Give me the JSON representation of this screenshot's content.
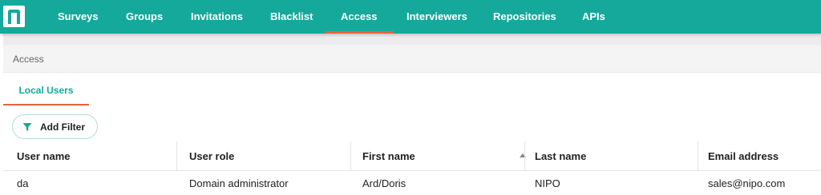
{
  "nav": {
    "items": [
      {
        "label": "Surveys"
      },
      {
        "label": "Groups"
      },
      {
        "label": "Invitations"
      },
      {
        "label": "Blacklist"
      },
      {
        "label": "Access",
        "active": true
      },
      {
        "label": "Interviewers"
      },
      {
        "label": "Repositories"
      },
      {
        "label": "APIs"
      }
    ]
  },
  "breadcrumb": "Access",
  "tabs": [
    {
      "label": "Local Users",
      "active": true
    }
  ],
  "toolbar": {
    "add_filter_label": "Add Filter"
  },
  "table": {
    "columns": [
      "User name",
      "User role",
      "First name",
      "Last name",
      "Email address"
    ],
    "sorted_column": "First name",
    "sort_direction": "ascending",
    "rows": [
      [
        "da",
        "Domain administrator",
        "Ard/Doris",
        "NIPO",
        "sales@nipo.com"
      ]
    ]
  },
  "colors": {
    "brand": "#14a99b",
    "accent": "#e8643a"
  },
  "icons": {
    "logo": "nipo-logo",
    "filter": "filter-icon",
    "sort": "sort-ascending-icon"
  }
}
